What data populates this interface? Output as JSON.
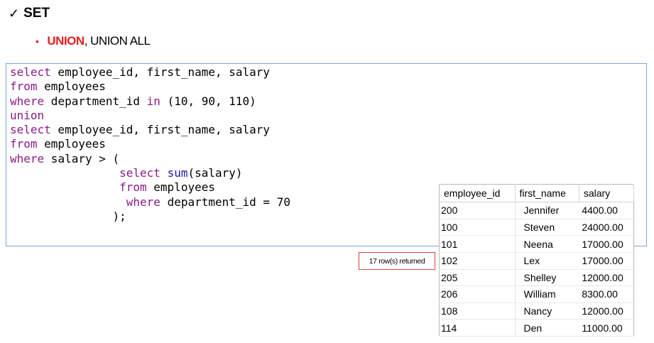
{
  "heading": {
    "check_glyph": "✓",
    "text": "SET"
  },
  "bullet": {
    "glyph": "•",
    "highlight": "UNION",
    "rest": ", UNION ALL"
  },
  "code_lines": [
    [
      {
        "t": "select",
        "c": "kw"
      },
      {
        "t": " employee_id, first_name, salary",
        "c": ""
      }
    ],
    [
      {
        "t": "from",
        "c": "kw"
      },
      {
        "t": " employees",
        "c": ""
      }
    ],
    [
      {
        "t": "where",
        "c": "kw"
      },
      {
        "t": " department_id ",
        "c": ""
      },
      {
        "t": "in",
        "c": "kw"
      },
      {
        "t": " (10, 90, 110)",
        "c": ""
      }
    ],
    [
      {
        "t": "union",
        "c": "kw"
      }
    ],
    [
      {
        "t": "select",
        "c": "kw"
      },
      {
        "t": " employee_id, first_name, salary",
        "c": ""
      }
    ],
    [
      {
        "t": "from",
        "c": "kw"
      },
      {
        "t": " employees",
        "c": ""
      }
    ],
    [
      {
        "t": "where",
        "c": "kw"
      },
      {
        "t": " salary > (",
        "c": ""
      }
    ],
    [
      {
        "t": "                ",
        "c": ""
      },
      {
        "t": "select",
        "c": "kw"
      },
      {
        "t": " ",
        "c": ""
      },
      {
        "t": "sum",
        "c": "fn"
      },
      {
        "t": "(salary)",
        "c": ""
      }
    ],
    [
      {
        "t": "                ",
        "c": ""
      },
      {
        "t": "from",
        "c": "kw"
      },
      {
        "t": " employees",
        "c": ""
      }
    ],
    [
      {
        "t": "                 ",
        "c": ""
      },
      {
        "t": "where",
        "c": "kw"
      },
      {
        "t": " department_id = 70",
        "c": ""
      }
    ],
    [
      {
        "t": "               );",
        "c": ""
      }
    ]
  ],
  "status": {
    "rows_returned": "17 row(s) returned"
  },
  "table": {
    "columns": [
      "employee_id",
      "first_name",
      "salary"
    ],
    "rows": [
      [
        "200",
        "Jennifer",
        "4400.00"
      ],
      [
        "100",
        "Steven",
        "24000.00"
      ],
      [
        "101",
        "Neena",
        "17000.00"
      ],
      [
        "102",
        "Lex",
        "17000.00"
      ],
      [
        "205",
        "Shelley",
        "12000.00"
      ],
      [
        "206",
        "William",
        "8300.00"
      ],
      [
        "108",
        "Nancy",
        "12000.00"
      ],
      [
        "114",
        "Den",
        "11000.00"
      ]
    ]
  },
  "colors": {
    "keyword": "#8b1a8b",
    "function": "#1a1aa8",
    "highlight": "#e02020",
    "panel_border": "#7ea6d8"
  }
}
